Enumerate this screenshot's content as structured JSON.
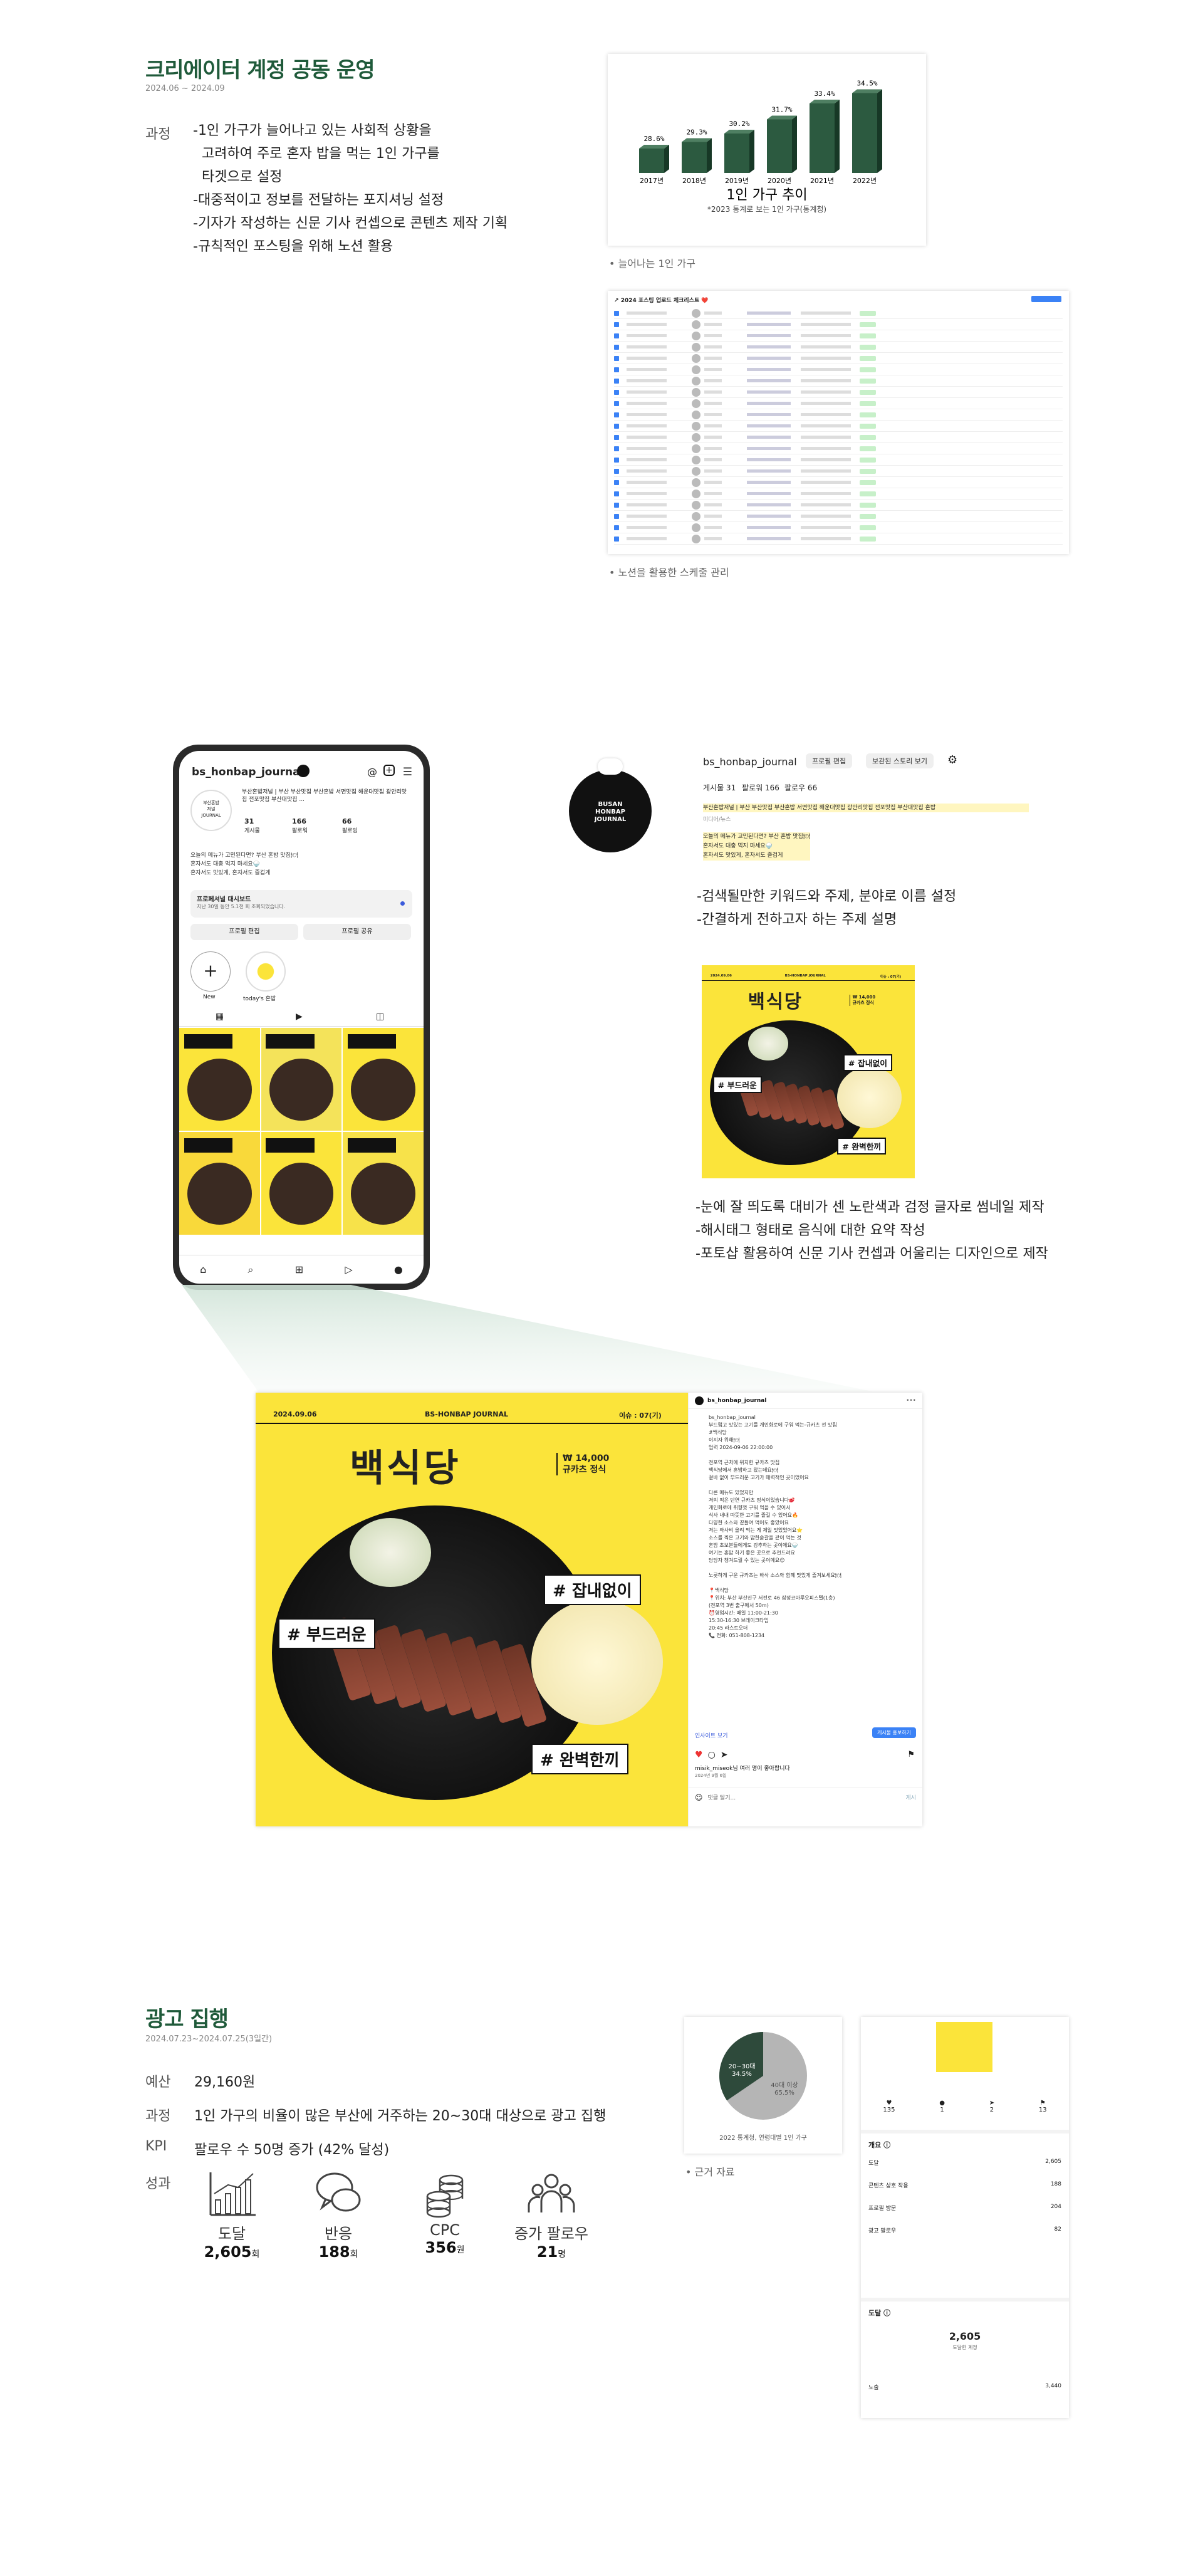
{
  "section1": {
    "title": "크리에이터 계정 공동 운영",
    "date": "2024.06 ~ 2024.09",
    "process_label": "과정",
    "process_lines": [
      "-1인 가구가 늘어나고 있는 사회적 상황을",
      "  고려하여 주로 혼자 밥을 먹는 1인 가구를",
      "  타겟으로 설정",
      "-대중적이고 정보를 전달하는 포지셔닝 설정",
      "-기자가 작성하는 신문 기사 컨셉으로 콘텐츠 제작 기획",
      "-규칙적인 포스팅을 위해 노션 활용"
    ],
    "chart_caption": "• 늘어나는 1인 가구",
    "sheet_caption": "• 노션을 활용한 스케줄 관리",
    "sheet_title": "2024 포스팅 업로드 체크리스트"
  },
  "chart_data": {
    "type": "bar",
    "title": "1인 가구 추이",
    "subtitle": "*2023 통계로 보는 1인 가구(통계청)",
    "categories": [
      "2017년",
      "2018년",
      "2019년",
      "2020년",
      "2021년",
      "2022년"
    ],
    "values": [
      28.6,
      29.3,
      30.2,
      31.7,
      33.4,
      34.5
    ],
    "value_labels": [
      "28.6%",
      "29.3%",
      "30.2%",
      "31.7%",
      "33.4%",
      "34.5%"
    ],
    "ylim": [
      0,
      36
    ]
  },
  "section2": {
    "phone": {
      "username": "bs_honbap_journal",
      "bio": "부산혼밥저널 | 부산 부산맛집 부산혼밥 서면맛집 해운대맛집 광안리맛집 전포맛집 부산대맛집 ...",
      "posts_count": "31",
      "followers_count": "166",
      "following_count": "66",
      "posts_label": "게시물",
      "followers_label": "팔로워",
      "following_label": "팔로잉",
      "dashboard": "프로페셔널 대시보드",
      "dashboard_sub": "지난 30일 동안 5.1천 회 조회되었습니다.",
      "edit_profile": "프로필 편집",
      "share_profile": "프로필 공유",
      "new_label": "New",
      "highlight_label": "today's 혼밥"
    },
    "profile": {
      "logo_text": "BUSAN HONBAP JOURNAL",
      "username": "bs_honbap_journal",
      "edit_btn": "프로필 편집",
      "archive_btn": "보관된 스토리 보기",
      "posts": "게시물 31",
      "followers": "팔로워 166",
      "following": "팔로우 66",
      "bio_line1": "부산혼밥저널 | 부산 부산맛집 부산혼밥 서면맛집 해운대맛집 광안리맛집 전포맛집 부산대맛집 혼밥",
      "bio_line2": "미디어/뉴스",
      "bio_line3": "오늘의 메뉴가 고민된다면? 부산 혼밥 맛집🍽",
      "bio_line4": "혼자서도 대충 먹지 마세요🍚",
      "bio_line5": "혼자서도 맛있게, 혼자서도 즐겁게"
    },
    "desc1": [
      "-검색될만한 키워드와 주제, 분야로 이름 설정",
      "-간결하게 전하고자 하는 주제 설명"
    ],
    "desc2": [
      "-눈에 잘 띄도록 대비가 센 노란색과 검정 글자로 썸네일 제작",
      "-해시태그 형태로 음식에 대한 요약 작성",
      "-포토샵 활용하여 신문 기사 컨셉과 어울리는 디자인으로 제작"
    ],
    "thumb": {
      "date": "2024.09.06",
      "brand": "BS-HONBAP JOURNAL",
      "issue": "이슈 : 07(기)",
      "name": "백식당",
      "price": "₩ 14,000",
      "menu": "규카츠 정식",
      "tag1": "# 부드러운",
      "tag2": "# 잡내없이",
      "tag3": "# 완벽한끼"
    },
    "post": {
      "username": "bs_honbap_journal",
      "caption_lines": [
        "bs_honbap_journal",
        "부드럽고 맛있는 고기를 개인화로에 구워 먹는-규카츠 전 맛집",
        "#백식당",
        "이지자 위해🍽",
        "업력 2024-09-06 22:00:00",
        "",
        "전포역 근처에 위치한 규카츠 맛집",
        "백식당에서 혼밥하고 왔는데요🍽",
        "겉바 없이 부드러운 고기가 매력적인 곳이었어요",
        "",
        "다른 메뉴도 있었지만",
        "저의 픽은 단연 규카츠 정식이었습니다🥩",
        "개인화로에 취향껏 구워 먹을 수 있어서",
        "식사 내내 따뜻한 고기를 즐길 수 있어요🔥",
        "다양한 소스와 곁들여 먹어도 좋았어요",
        "저는 와사비 올려 먹는 게 제일 맛있었어요⭐",
        "소스를 찍은 고기와 밥한숟갈을 같이 먹는 것",
        "혼밥 초보분들에게도 강추하는 곳이에요🍚",
        "여기는 혼밥 하기 좋은 곳으로 추천드려요",
        "담당자 챙겨드릴 수 있는 곳이에요😊",
        "",
        "노릇하게 구운 규카츠는 바삭 소스와 함께 맛있게 즐겨보세요🍽",
        "",
        "📍백식당",
        "📍위치: 부산 부산진구 서전로 46 삼정코아루오피스텔(1층)",
        "   (전포역 3번 출구에서 50m)",
        "⏰영업시간: 매일 11:00-21:30",
        "   15:30-16:30 브레이크타임",
        "   20:45 라스트오더",
        "📞 전화: 051-808-1234"
      ],
      "insight_link": "인사이트 보기",
      "boost_btn": "게시물 홍보하기",
      "likes": "misik_miseok님 여러 명이 좋아합니다",
      "post_date": "2024년 9월 6일",
      "comment_placeholder": "댓글 달기...",
      "post_btn": "게시"
    }
  },
  "section3": {
    "title": "광고 집행",
    "date": "2024.07.23~2024.07.25(3일간)",
    "budget_label": "예산",
    "budget": "29,160원",
    "process_label": "과정",
    "process": "1인 가구의 비율이 많은 부산에 거주하는 20~30대 대상으로 광고 집행",
    "kpi_label": "KPI",
    "kpi": "팔로우 수 50명 증가 (42% 달성)",
    "result_label": "성과",
    "stats": [
      {
        "label": "도달",
        "value": "2,605",
        "unit": "회",
        "icon": "growth-chart-icon"
      },
      {
        "label": "반응",
        "value": "188",
        "unit": "회",
        "icon": "speech-bubbles-icon"
      },
      {
        "label": "CPC",
        "value": "356",
        "unit": "원",
        "icon": "coin-stack-icon"
      },
      {
        "label": "증가 팔로우",
        "value": "21",
        "unit": "명",
        "icon": "people-group-icon"
      }
    ],
    "pie_caption": "• 근거 자료",
    "pie_note": "2022 통계청, 연령대별 1인 가구",
    "pie_labels": [
      "20~30대\n34.5%",
      "40대 이상\n65.5%"
    ],
    "insights": {
      "likes": "135",
      "comments": "1",
      "shares": "2",
      "saves": "13",
      "overview_title": "개요 ⓘ",
      "rows": [
        {
          "label": "도달",
          "value": "2,605"
        },
        {
          "label": "콘텐츠 상호 작용",
          "value": "188"
        },
        {
          "label": "프로필 방문",
          "value": "204"
        },
        {
          "label": "광고 팔로우",
          "value": "82"
        }
      ],
      "reach_title": "도달 ⓘ",
      "reach_value": "2,605",
      "reach_sub": "도달한 계정",
      "reach_bottom_label": "노출",
      "reach_bottom_value": "3,440"
    }
  },
  "colors": {
    "brand_green": "#1f5a3a",
    "thumb_yellow": "#fbe43a",
    "instagram_blue": "#3b82f6",
    "pie_green": "#2e4a3b",
    "pie_gray": "#b5b5b5"
  }
}
